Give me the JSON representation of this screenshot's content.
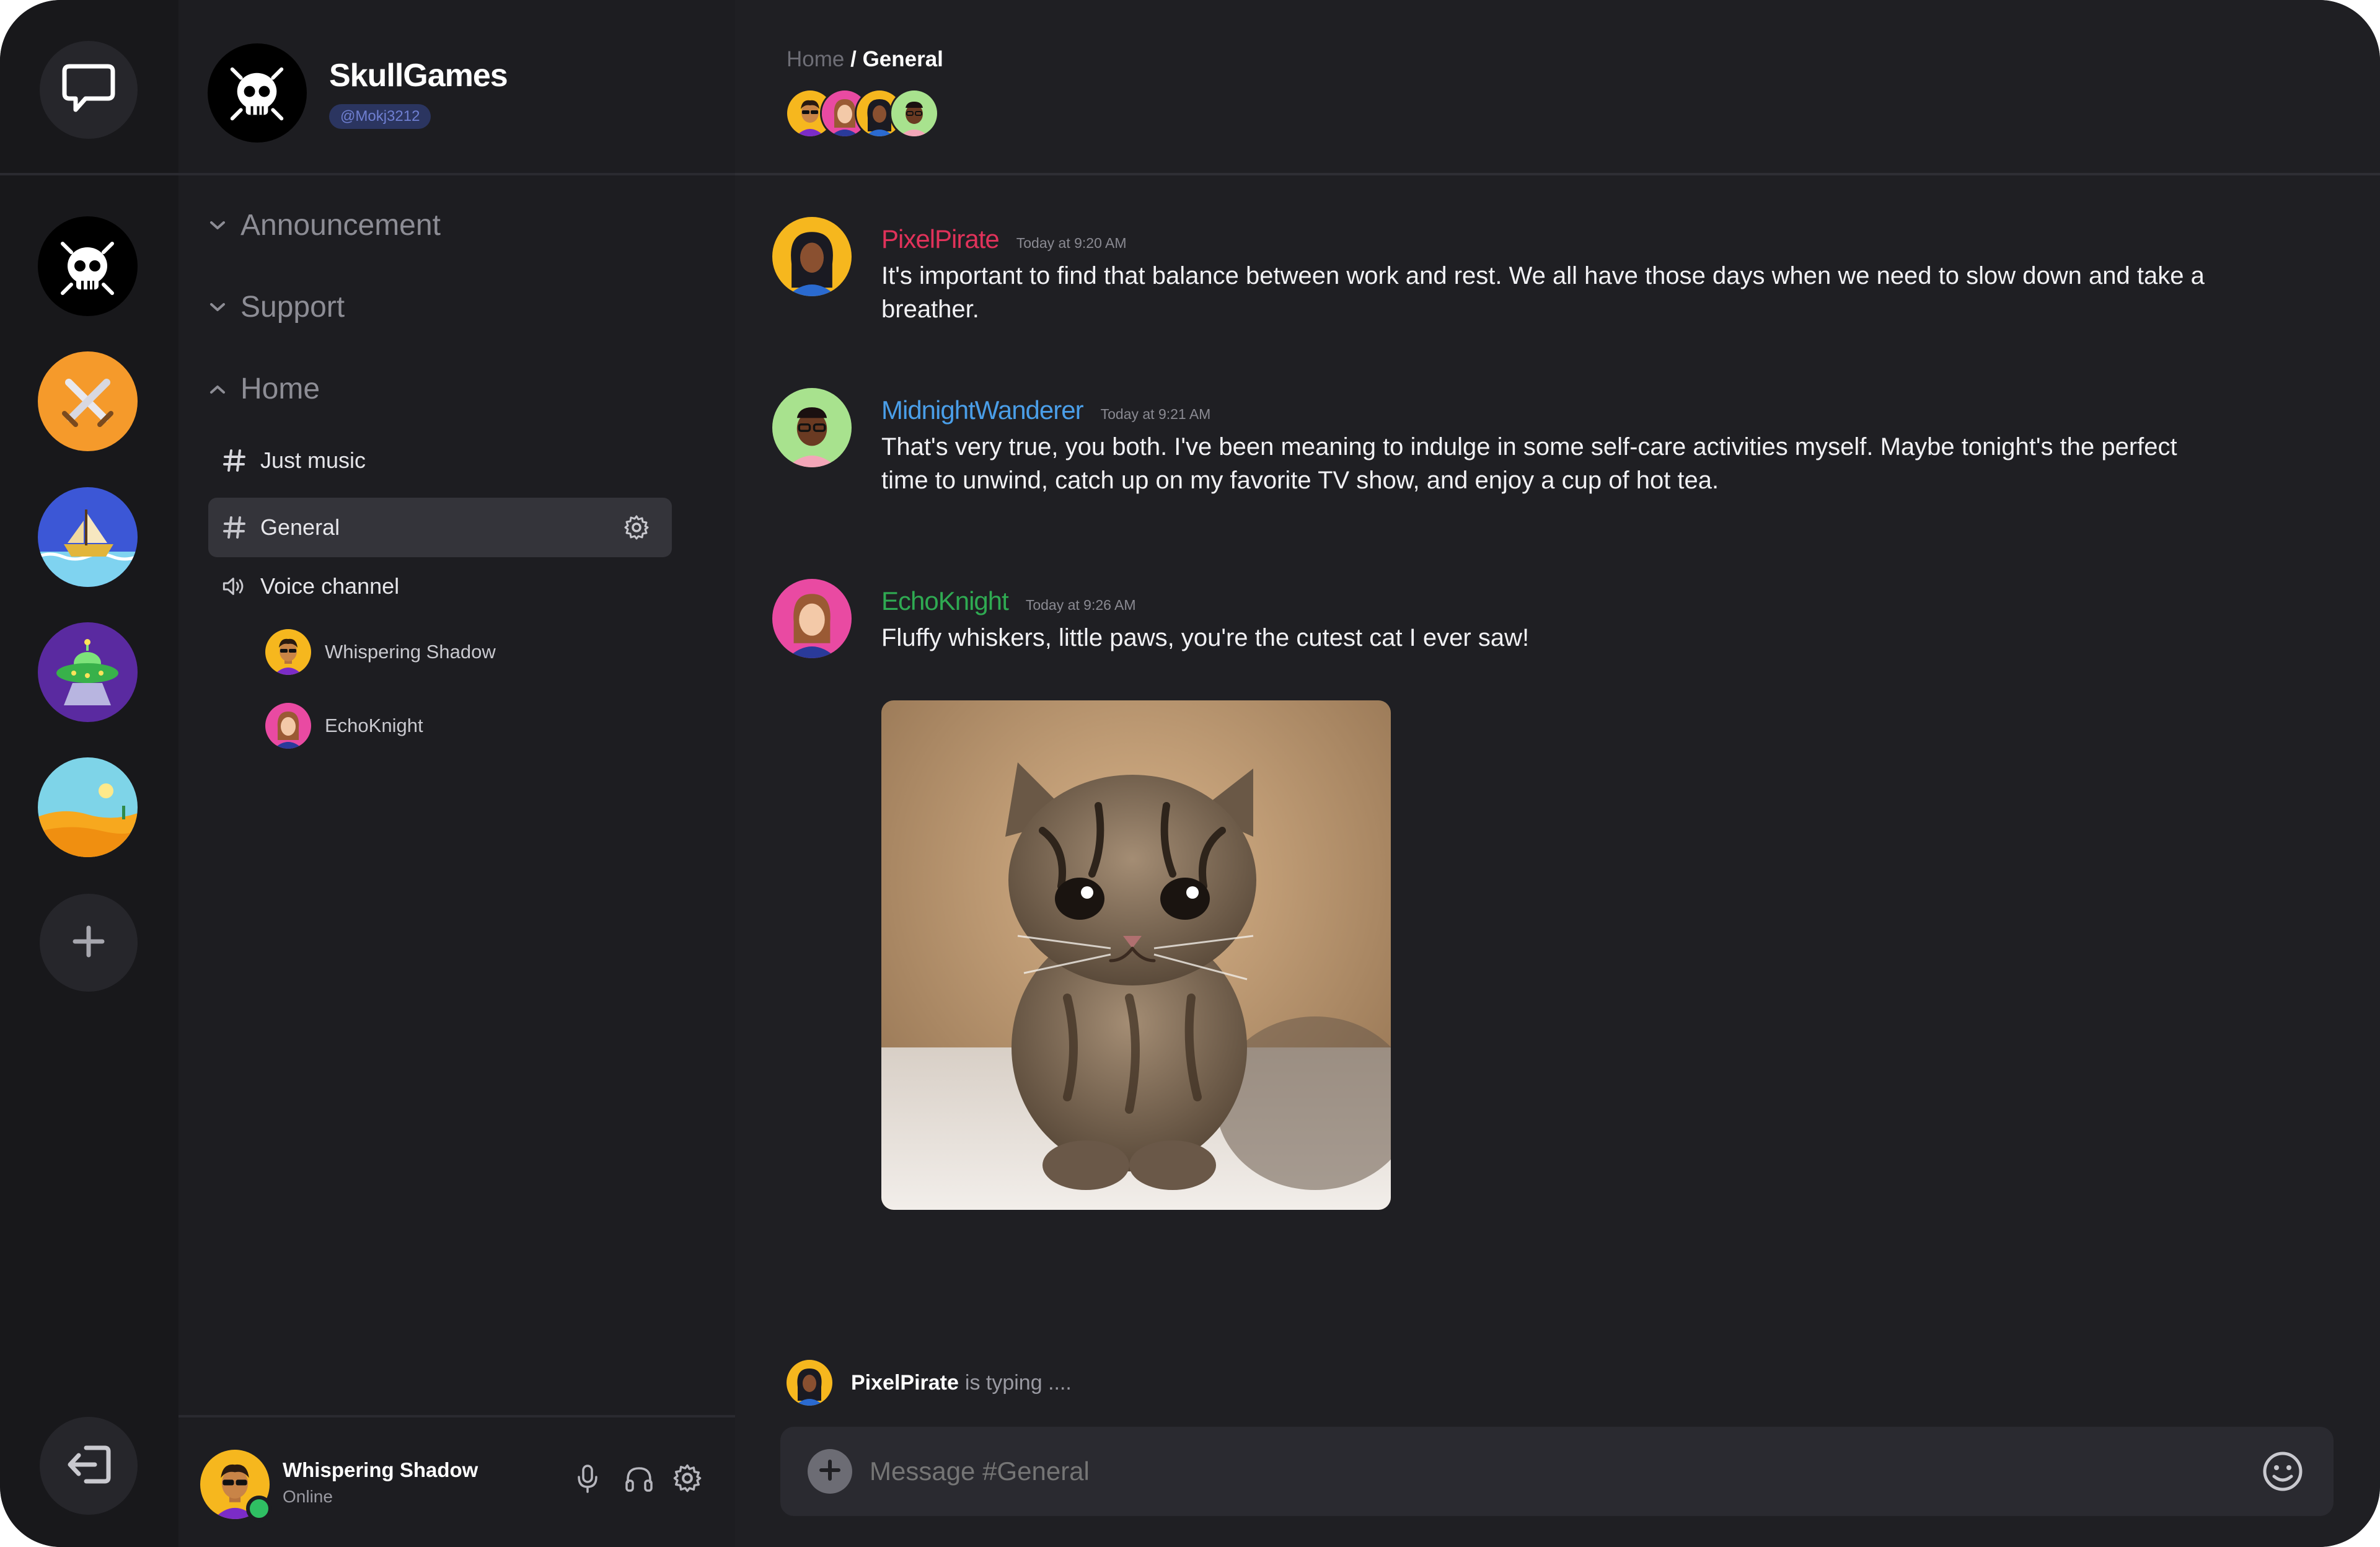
{
  "server": {
    "name": "SkullGames",
    "handle": "@Mokj3212"
  },
  "rail": {
    "top_icon": "chat-bubble-icon",
    "servers": [
      "skull-server",
      "swords-server",
      "ship-server",
      "ufo-server",
      "desert-server"
    ],
    "add_icon": "plus-icon",
    "logout_icon": "logout-icon"
  },
  "sidebar": {
    "categories": [
      {
        "label": "Announcement",
        "expanded": false
      },
      {
        "label": "Support",
        "expanded": false
      },
      {
        "label": "Home",
        "expanded": true
      }
    ],
    "channels": [
      {
        "label": "Just music",
        "type": "text",
        "active": false
      },
      {
        "label": "General",
        "type": "text",
        "active": true
      }
    ],
    "voice_channel": {
      "label": "Voice channel",
      "users": [
        "Whispering Shadow",
        "EchoKnight"
      ]
    }
  },
  "user_panel": {
    "name": "Whispering Shadow",
    "status": "Online"
  },
  "header": {
    "breadcrumb_parent": "Home",
    "breadcrumb_separator": " / ",
    "breadcrumb_current": "General"
  },
  "messages": [
    {
      "user": "PixelPirate",
      "color": "#e0325a",
      "time": "Today at 9:20 AM",
      "text": "It's important to find that balance between work and rest. We all have those days when we need to slow down and take a breather."
    },
    {
      "user": "MidnightWanderer",
      "color": "#4a9ee8",
      "time": "Today at 9:21 AM",
      "text": "That's very true, you both. I've been meaning to indulge in some self-care activities myself. Maybe tonight's the perfect time to unwind, catch up on my favorite TV show, and enjoy a cup of hot tea."
    },
    {
      "user": "EchoKnight",
      "color": "#2faa52",
      "time": "Today at 9:26 AM",
      "text": "Fluffy whiskers, little paws, you're the cutest cat I ever saw!"
    }
  ],
  "typing": {
    "user": "PixelPirate",
    "suffix": "is typing ...."
  },
  "composer": {
    "placeholder": "Message #General"
  },
  "colors": {
    "background": "#1f1f23",
    "rail": "#18181b",
    "sidebar": "#1d1d21",
    "active_channel": "#34343a",
    "handle_badge": "#2b3560",
    "online": "#2fbf63"
  }
}
